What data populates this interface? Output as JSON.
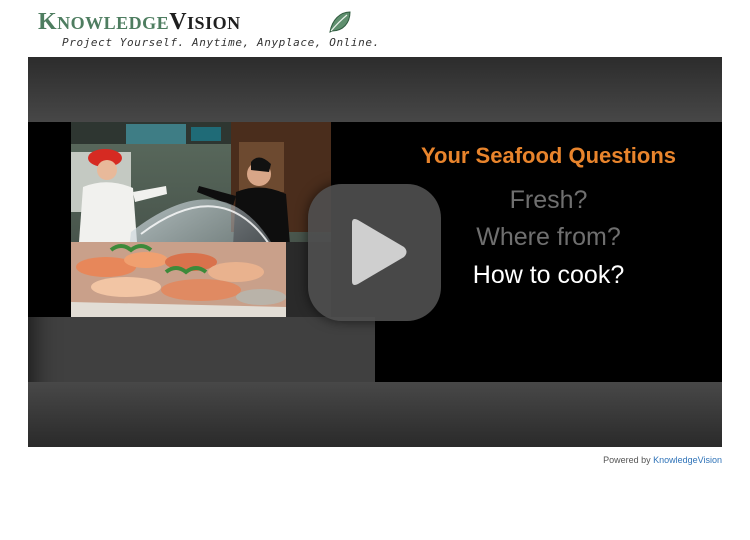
{
  "header": {
    "logo_knowledge_first": "K",
    "logo_knowledge_rest": "NOWLEDGE",
    "logo_vision_first": "V",
    "logo_vision_rest": "ISION",
    "tagline": "Project Yourself. Anytime, Anyplace, Online."
  },
  "player": {
    "slide": {
      "title": "Your Seafood Questions",
      "questions": [
        "Fresh?",
        "Where from?",
        "How to cook?"
      ]
    },
    "play_icon": "play-icon"
  },
  "footer": {
    "powered_by_label": "Powered by",
    "powered_by_link": "KnowledgeVision"
  },
  "colors": {
    "brand_green": "#4e7d60",
    "slide_title": "#e8842c",
    "link": "#2f73b8",
    "player_bg": "#404040"
  }
}
